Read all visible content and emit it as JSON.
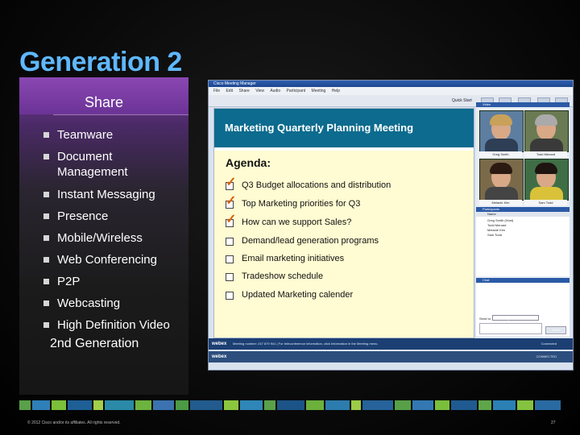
{
  "slide": {
    "title": "Generation 2",
    "panel": {
      "heading": "Share",
      "bullets": [
        "Teamware",
        "Document",
        "Management",
        "Instant Messaging",
        "Presence",
        "Mobile/Wireless",
        "Web Conferencing",
        "P2P",
        "Webcasting",
        "High Definition Video"
      ],
      "caption": "2nd Generation"
    },
    "footer": {
      "copyright": "© 2012 Cisco and/or its affiliates. All rights reserved.",
      "page": "27"
    }
  },
  "screenshot": {
    "window_title": "Cisco Meeting Manager",
    "menu": [
      "File",
      "Edit",
      "Share",
      "View",
      "Audio",
      "Participant",
      "Meeting",
      "Help"
    ],
    "quick_start": "Quick Start",
    "meeting_title": "Marketing Quarterly Planning Meeting",
    "agenda_heading": "Agenda:",
    "agenda_items": [
      {
        "text": "Q3 Budget allocations and distribution",
        "checked": true
      },
      {
        "text": "Top Marketing priorities for Q3",
        "checked": true
      },
      {
        "text": "How can we support Sales?",
        "checked": true
      },
      {
        "text": "Demand/lead generation programs",
        "checked": false
      },
      {
        "text": "Email marketing initiatives",
        "checked": false
      },
      {
        "text": "Tradeshow schedule",
        "checked": false
      },
      {
        "text": "Updated Marketing calender",
        "checked": false
      }
    ],
    "video_panel": "Video",
    "video_names": [
      "Greg Smith",
      "Todd Menard",
      "Melanie Kim",
      "Sam Todd"
    ],
    "participants_panel": "Participants",
    "participants_header": "Name",
    "participants": [
      "Greg Smith (Host)",
      "Todd Menard",
      "Melanie Kim",
      "Sam Todd"
    ],
    "chat_panel": "Chat",
    "send_to_label": "Send to:",
    "send_to_value": "All Participants",
    "send_button": "Send",
    "status_webex": "webex",
    "status_line1": "Meeting number: 247 879 941  |  For teleconference information, click Information in the Meeting menu.",
    "status_line1_right": "Connected",
    "status_line2_right": "CONNECTED"
  },
  "colors": {
    "title": "#5fb8ff",
    "panel_purple": "#7b3aa0",
    "meeting_bar": "#0c6b8e",
    "agenda_bg": "#fffbd2",
    "check": "#d7620f"
  }
}
